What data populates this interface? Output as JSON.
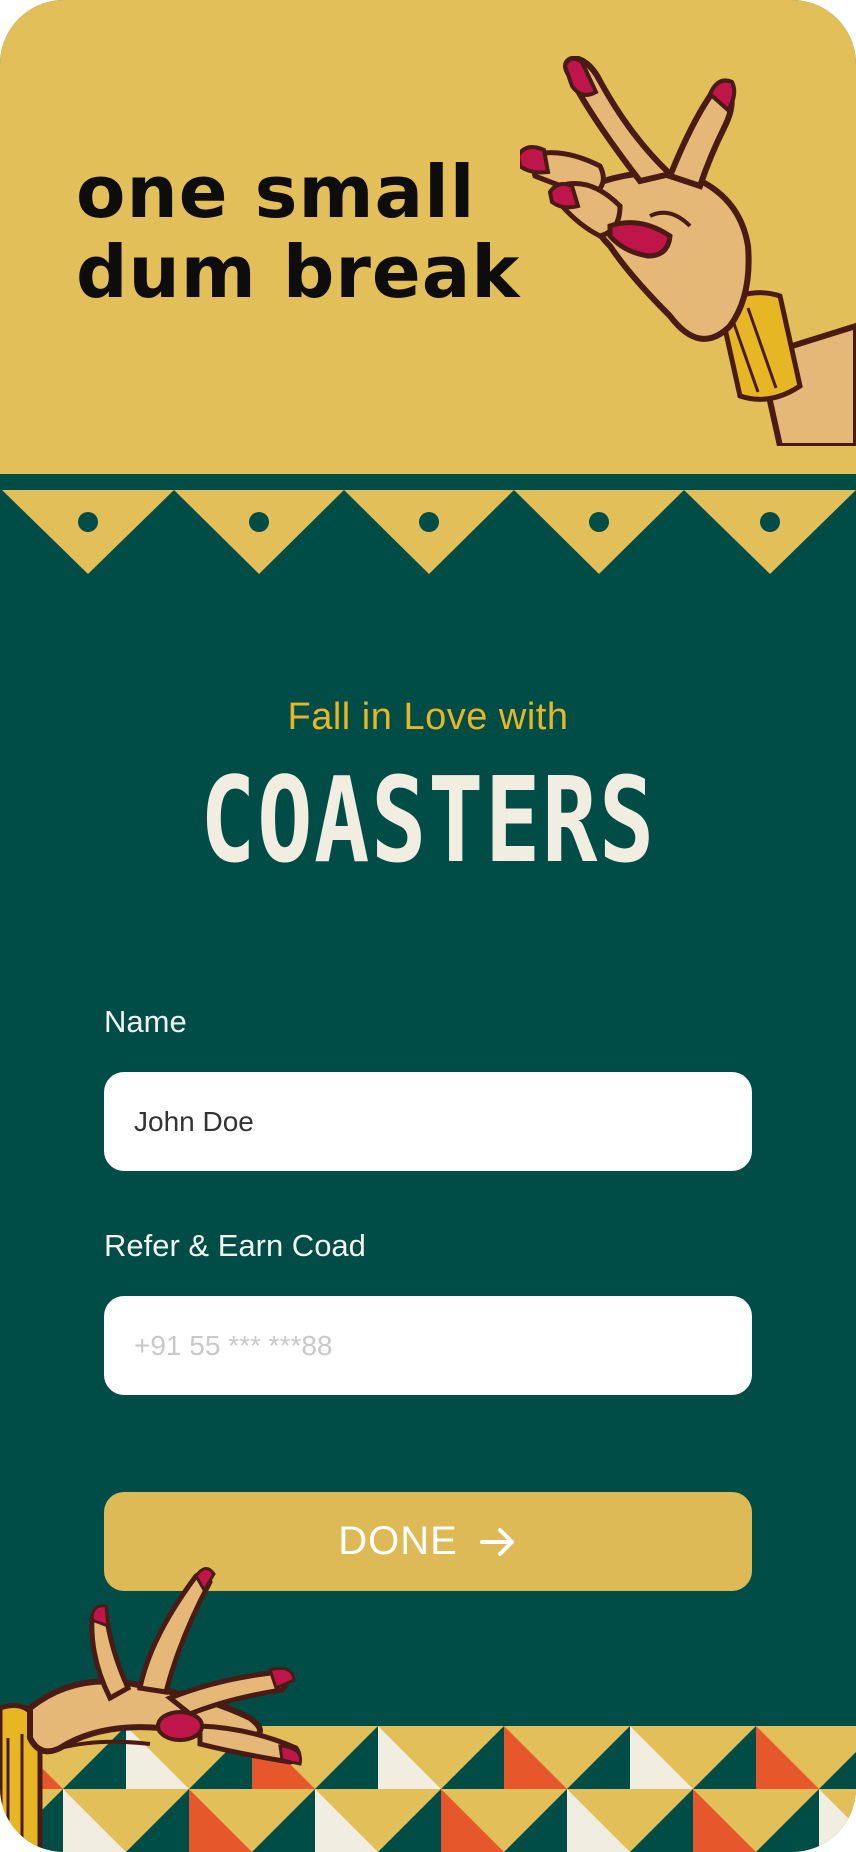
{
  "header": {
    "title": "one small\ndum break"
  },
  "hero": {
    "subtitle": "Fall in Love with",
    "brand": "COASTERS"
  },
  "form": {
    "name_label": "Name",
    "name_value": "John Doe",
    "referral_label": "Refer & Earn Coad",
    "referral_placeholder": "+91 55 *** ***88",
    "done_label": "DONE"
  },
  "colors": {
    "mustard": "#e2bf58",
    "teal": "#004d47",
    "accent_yellow": "#e7b625",
    "cream": "#f1ede1",
    "orange": "#e6572b",
    "nail_red": "#c0154a"
  },
  "icons": {
    "done_arrow": "arrow-right-icon",
    "hand_top": "mudra-hand-illustration",
    "hand_bottom": "dancer-hand-illustration"
  }
}
